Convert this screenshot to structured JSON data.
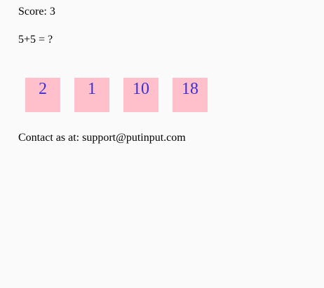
{
  "score": {
    "text": "Score: 3"
  },
  "question": {
    "text": "5+5 = ?"
  },
  "answers": [
    {
      "label": "2"
    },
    {
      "label": "1"
    },
    {
      "label": "10"
    },
    {
      "label": "18"
    }
  ],
  "footer": {
    "contact_text": "Contact as at: support@putinput.com"
  },
  "colors": {
    "answer_bg": "#ffc0cb",
    "answer_text": "#3a30d6",
    "page_bg": "#fafafa"
  }
}
